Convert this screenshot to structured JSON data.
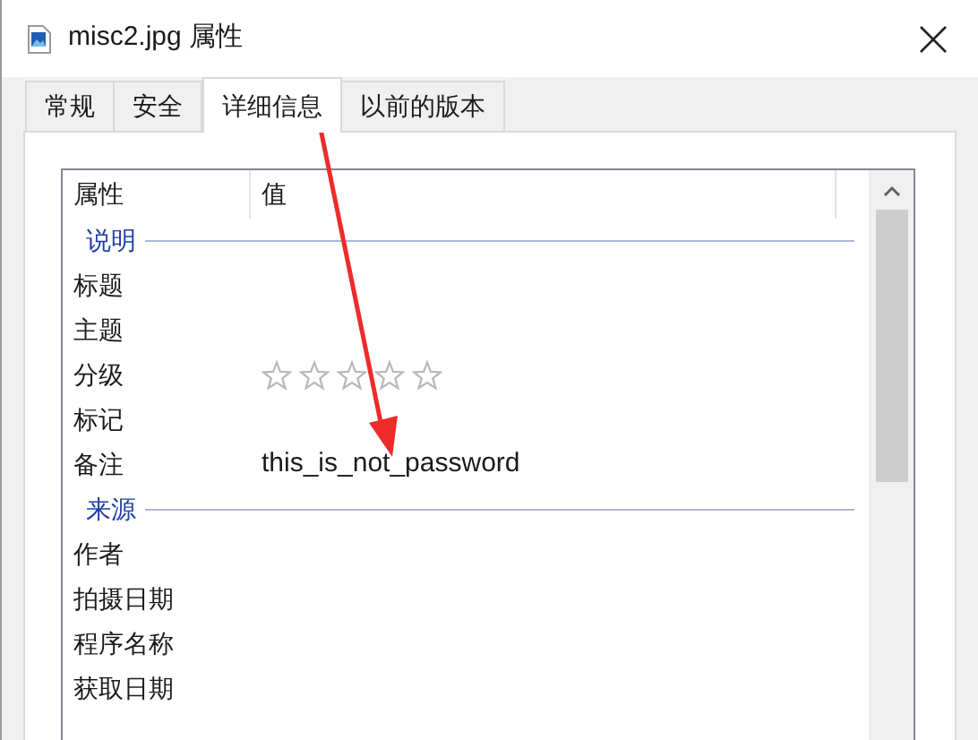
{
  "window": {
    "title": "misc2.jpg 属性"
  },
  "tabs": [
    {
      "label": "常规",
      "selected": false
    },
    {
      "label": "安全",
      "selected": false
    },
    {
      "label": "详细信息",
      "selected": true
    },
    {
      "label": "以前的版本",
      "selected": false
    }
  ],
  "table": {
    "columns": [
      "属性",
      "值"
    ],
    "groups": [
      {
        "label": "说明",
        "rows": [
          {
            "kind": "text",
            "name": "标题"
          },
          {
            "kind": "text",
            "name": "主题"
          },
          {
            "kind": "rating",
            "name": "分级",
            "stars": 0
          },
          {
            "kind": "text",
            "name": "标记"
          },
          {
            "kind": "text",
            "name": "备注",
            "value": "this_is_not_password"
          }
        ]
      },
      {
        "label": "来源",
        "rows": [
          {
            "kind": "text",
            "name": "作者"
          },
          {
            "kind": "text",
            "name": "拍摄日期"
          },
          {
            "kind": "text",
            "name": "程序名称"
          },
          {
            "kind": "text",
            "name": "获取日期"
          }
        ]
      }
    ]
  }
}
